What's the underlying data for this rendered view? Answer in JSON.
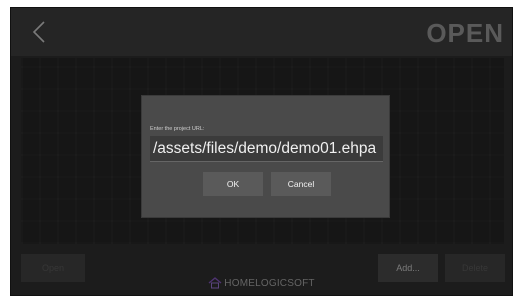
{
  "header": {
    "back_icon": "chevron-left-icon",
    "title": "OPEN"
  },
  "dialog": {
    "label": "Enter the project URL:",
    "url_value": "/assets/files/demo/demo01.ehpa",
    "ok_label": "OK",
    "cancel_label": "Cancel"
  },
  "bottom": {
    "open_label": "Open",
    "add_label": "Add...",
    "delete_label": "Delete"
  },
  "footer": {
    "logo_text": "HOMELOGICSOFT",
    "logo_icon": "homelogicsoft-logo"
  },
  "colors": {
    "background": "#2b2b2b",
    "dialog": "#4a4a4a",
    "button": "#5a5a5a",
    "title_text": "#8a8a8a",
    "logo_accent": "#7a4fb0"
  }
}
